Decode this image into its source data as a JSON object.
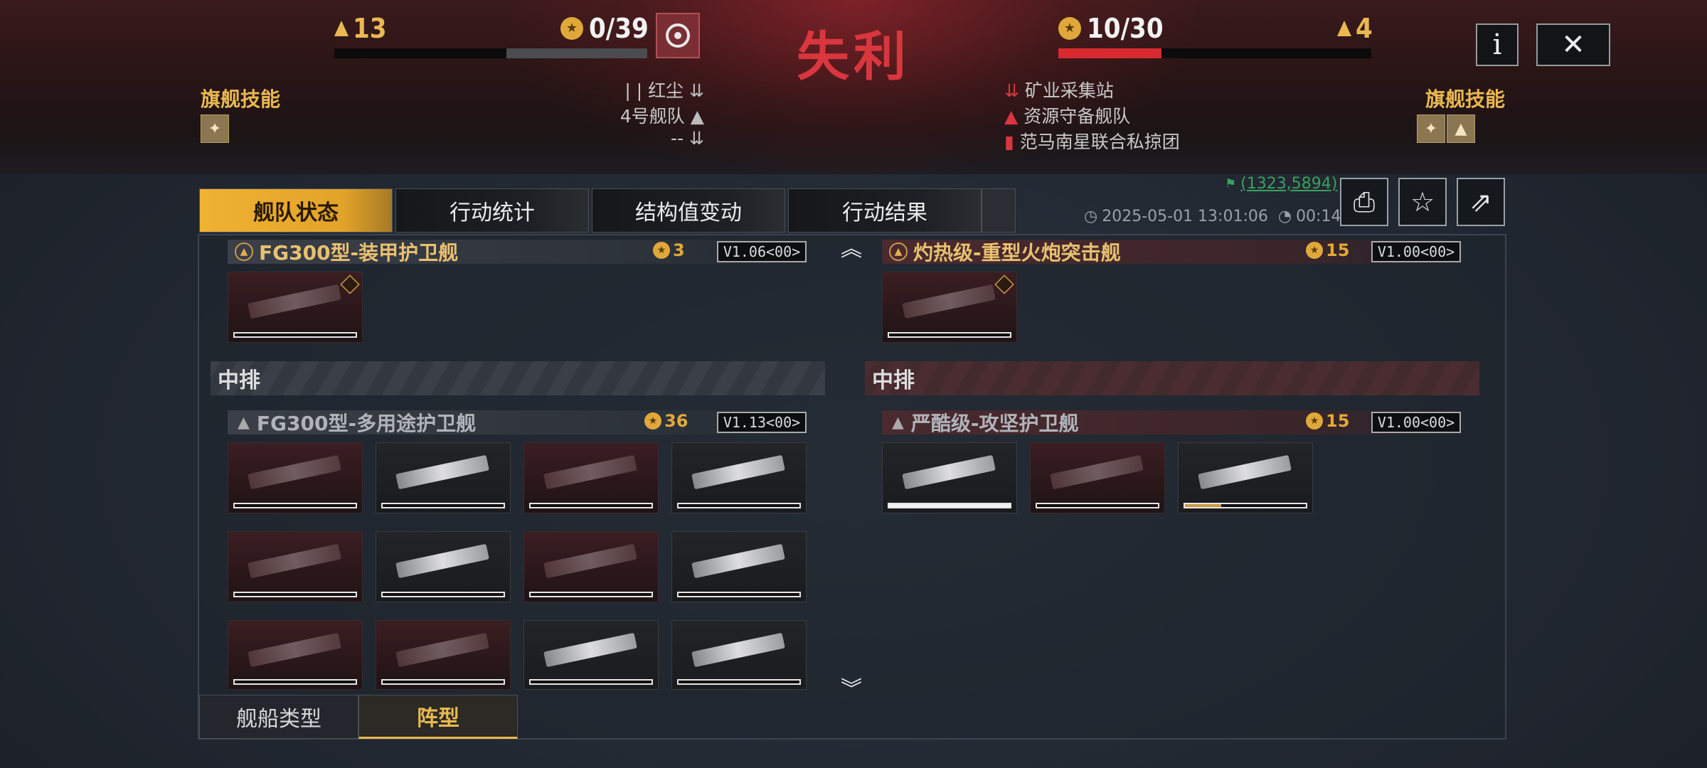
{
  "header": {
    "result": "失利",
    "left": {
      "level": "13",
      "score": "0/39",
      "bar_fill_fraction": 0.45
    },
    "right": {
      "level": "4",
      "score": "10/30",
      "bar_fill_fraction": 0.33
    },
    "left_skill_label": "旗舰技能",
    "right_skill_label": "旗舰技能",
    "left_info": [
      "| | 红尘",
      "4号舰队",
      "--"
    ],
    "right_info": [
      "矿业采集站",
      "资源守备舰队",
      "范马南星联合私掠团"
    ],
    "info_button": "i"
  },
  "tabs": [
    "舰队状态",
    "行动统计",
    "结构值变动",
    "行动结果"
  ],
  "meta": {
    "coords": "(1323,5894)",
    "datetime": "2025-05-01 13:01:06",
    "duration": "00:14:48"
  },
  "left_fleet": {
    "group1": {
      "name": "FG300型-装甲护卫舰",
      "count": "3",
      "version": "V1.06<00>"
    },
    "row_label": "中排",
    "group2": {
      "name": "FG300型-多用途护卫舰",
      "count": "36",
      "version": "V1.13<00>"
    }
  },
  "right_fleet": {
    "group1": {
      "name": "灼热级-重型火炮突击舰",
      "count": "15",
      "version": "V1.00<00>"
    },
    "row_label": "中排",
    "group2": {
      "name": "严酷级-攻坚护卫舰",
      "count": "15",
      "version": "V1.00<00>",
      "hp_fractions": [
        1.0,
        0.0,
        0.3
      ]
    }
  },
  "bottom_tabs": [
    "舰船类型",
    "阵型"
  ],
  "colors": {
    "accent": "#e9b850",
    "defeat": "#d9363e",
    "hp_bar": "#d82a2e"
  }
}
